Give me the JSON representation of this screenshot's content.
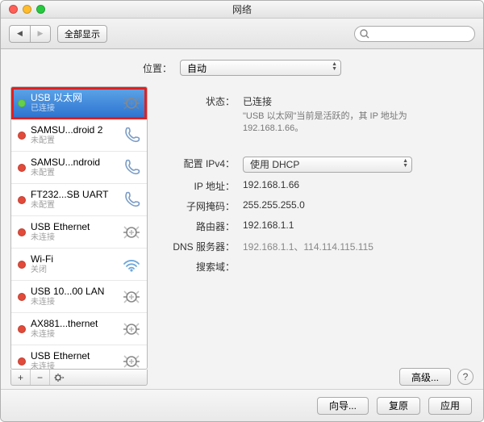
{
  "window": {
    "title": "网络"
  },
  "toolbar": {
    "show_all": "全部显示",
    "search_placeholder": ""
  },
  "location": {
    "label": "位置：",
    "value": "自动"
  },
  "sidebar": {
    "items": [
      {
        "name": "USB 以太网",
        "status": "已连接",
        "status_color": "green",
        "icon": "ethernet"
      },
      {
        "name": "SAMSU...droid 2",
        "status": "未配置",
        "status_color": "red",
        "icon": "phone"
      },
      {
        "name": "SAMSU...ndroid",
        "status": "未配置",
        "status_color": "red",
        "icon": "phone"
      },
      {
        "name": "FT232...SB UART",
        "status": "未配置",
        "status_color": "red",
        "icon": "phone"
      },
      {
        "name": "USB Ethernet",
        "status": "未连接",
        "status_color": "red",
        "icon": "ethernet"
      },
      {
        "name": "Wi-Fi",
        "status": "关闭",
        "status_color": "red",
        "icon": "wifi"
      },
      {
        "name": "USB 10...00 LAN",
        "status": "未连接",
        "status_color": "red",
        "icon": "ethernet"
      },
      {
        "name": "AX881...thernet",
        "status": "未连接",
        "status_color": "red",
        "icon": "ethernet"
      },
      {
        "name": "USB Ethernet",
        "status": "未连接",
        "status_color": "red",
        "icon": "ethernet"
      }
    ]
  },
  "detail": {
    "status_label": "状态：",
    "status_value": "已连接",
    "status_hint": "\"USB 以太网\"当前是活跃的，其 IP 地址为 192.168.1.66。",
    "ipv4_label": "配置 IPv4：",
    "ipv4_value": "使用 DHCP",
    "ip_label": "IP 地址：",
    "ip_value": "192.168.1.66",
    "mask_label": "子网掩码：",
    "mask_value": "255.255.255.0",
    "router_label": "路由器：",
    "router_value": "192.168.1.1",
    "dns_label": "DNS 服务器：",
    "dns_value": "192.168.1.1、114.114.115.115",
    "search_label": "搜索域：",
    "search_value": "",
    "advanced": "高级...",
    "help": "?"
  },
  "footer": {
    "assist": "向导...",
    "revert": "复原",
    "apply": "应用"
  }
}
